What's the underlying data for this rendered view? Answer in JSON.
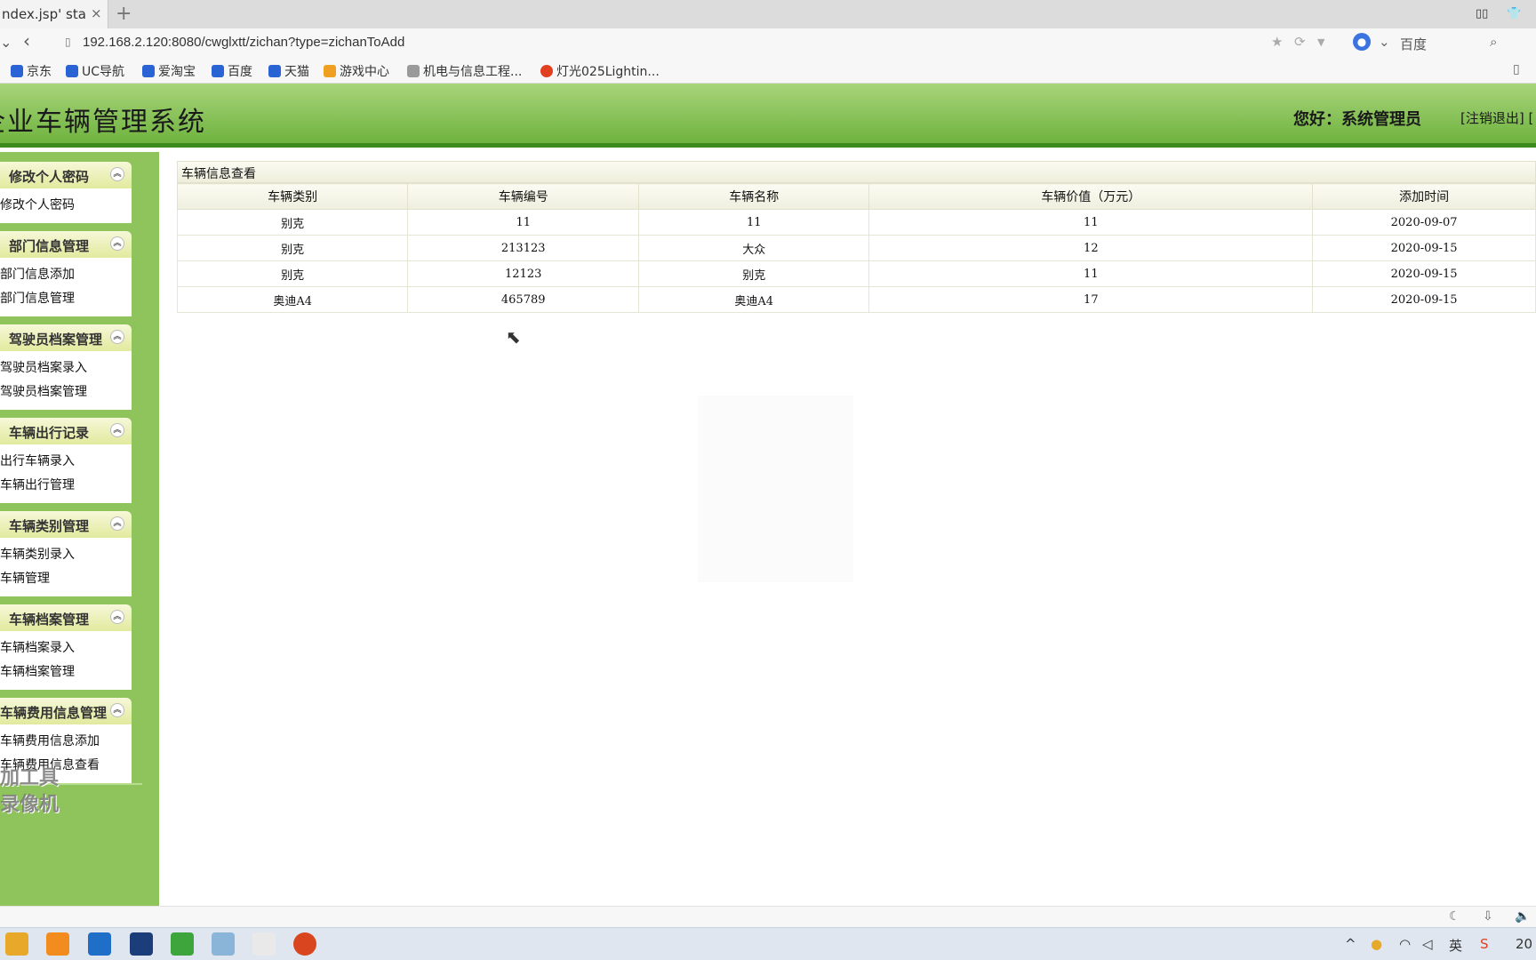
{
  "browser": {
    "tab_title": "ndex.jsp' sta",
    "tab_close": "×",
    "new_tab": "+",
    "url": "192.168.2.120:8080/cwglxtt/zichan?type=zichanToAdd",
    "search_engine_label": "百度",
    "bookmarks": [
      "京东",
      "UC导航",
      "爱淘宝",
      "百度",
      "天猫",
      "游戏中心",
      "机电与信息工程...",
      "灯光025Lightin..."
    ]
  },
  "header": {
    "title": "企业车辆管理系统",
    "greeting": "您好：系统管理员",
    "logout": "[注销退出] ["
  },
  "sidebar": {
    "groups": [
      {
        "title": "修改个人密码",
        "items": [
          "修改个人密码"
        ]
      },
      {
        "title": "部门信息管理",
        "items": [
          "部门信息添加",
          "部门信息管理"
        ]
      },
      {
        "title": "驾驶员档案管理",
        "items": [
          "驾驶员档案录入",
          "驾驶员档案管理"
        ]
      },
      {
        "title": "车辆出行记录",
        "items": [
          "出行车辆录入",
          "车辆出行管理"
        ]
      },
      {
        "title": "车辆类别管理",
        "items": [
          "车辆类别录入",
          "车辆管理"
        ]
      },
      {
        "title": "车辆档案管理",
        "items": [
          "车辆档案录入",
          "车辆档案管理"
        ]
      },
      {
        "title": "车辆费用信息管理",
        "items": [
          "车辆费用信息添加",
          "车辆费用信息查看"
        ]
      }
    ],
    "watermark_line1": "加工具",
    "watermark_line2": "录像机"
  },
  "main": {
    "panel_title": "车辆信息查看",
    "columns": [
      "车辆类别",
      "车辆编号",
      "车辆名称",
      "车辆价值（万元）",
      "添加时间"
    ],
    "rows": [
      [
        "别克",
        "11",
        "11",
        "11",
        "2020-09-07"
      ],
      [
        "别克",
        "213123",
        "大众",
        "12",
        "2020-09-15"
      ],
      [
        "别克",
        "12123",
        "别克",
        "11",
        "2020-09-15"
      ],
      [
        "奥迪A4",
        "465789",
        "奥迪A4",
        "17",
        "2020-09-15"
      ]
    ]
  },
  "taskbar": {
    "clock": "20",
    "ime": "英"
  }
}
